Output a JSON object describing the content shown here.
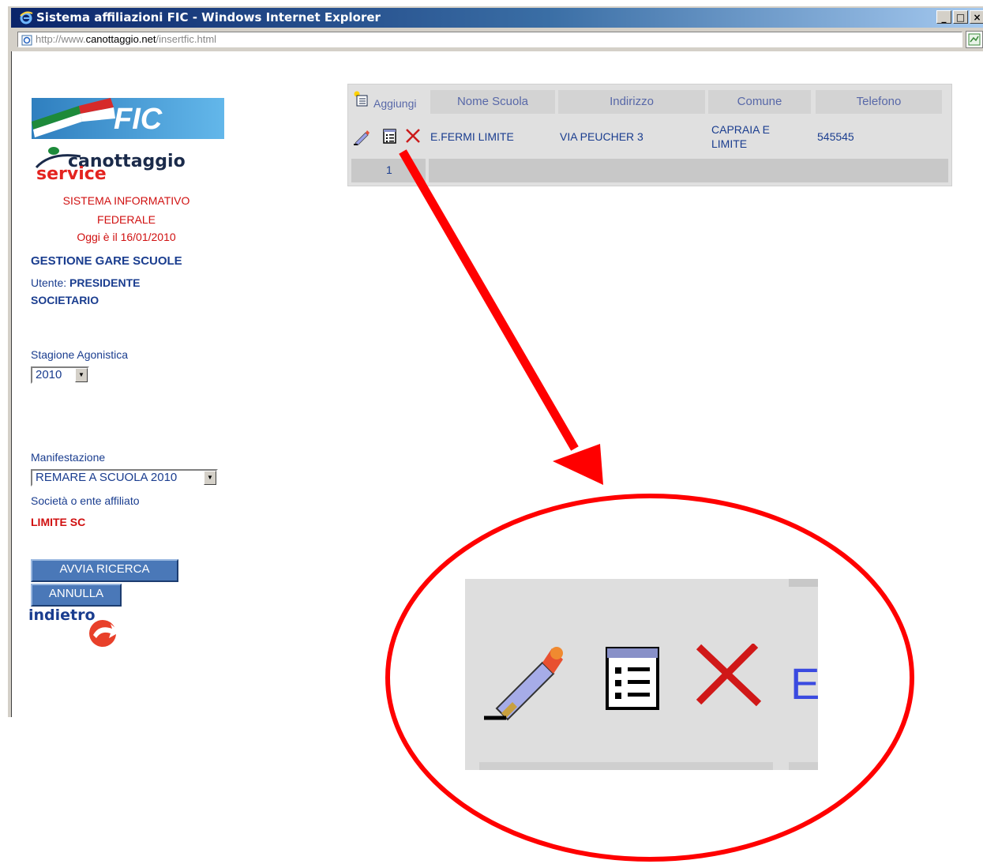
{
  "window": {
    "title": "Sistema affiliazioni FIC - Windows Internet Explorer",
    "controls": [
      "_",
      "□",
      "×"
    ]
  },
  "address": {
    "prefix": "http://www.",
    "host": "canottaggio.net",
    "path": "/insertfic.html"
  },
  "sidebar": {
    "fic_logo_text": "FIC",
    "brand_line1": "canottaggio",
    "brand_line2": "service",
    "system_title": "SISTEMA INFORMATIVO FEDERALE",
    "date_text": "Oggi è il 16/01/2010",
    "section_title": "GESTIONE GARE SCUOLE",
    "user_label": "Utente:",
    "user_value": "PRESIDENTE SOCIETARIO",
    "season_label": "Stagione Agonistica",
    "season_value": "2010",
    "event_label": "Manifestazione",
    "event_value": "REMARE A SCUOLA 2010",
    "club_label": "Società o ente affiliato",
    "club_value": "LIMITE SC",
    "search_button": "AVVIA RICERCA",
    "cancel_button": "ANNULLA",
    "back_link": "indietro"
  },
  "grid": {
    "add_label": "Aggiungi",
    "columns": [
      "Nome Scuola",
      "Indirizzo",
      "Comune",
      "Telefono"
    ],
    "rows": [
      {
        "nome": "E.FERMI LIMITE",
        "indirizzo": "VIA PEUCHER 3",
        "comune": "CAPRAIA E LIMITE",
        "telefono": "545545"
      }
    ],
    "page": "1"
  },
  "zoom": {
    "edge_letter": "E"
  },
  "colors": {
    "annotation": "#ff0000",
    "link_blue": "#1a3d8f",
    "alert_red": "#d01010"
  }
}
